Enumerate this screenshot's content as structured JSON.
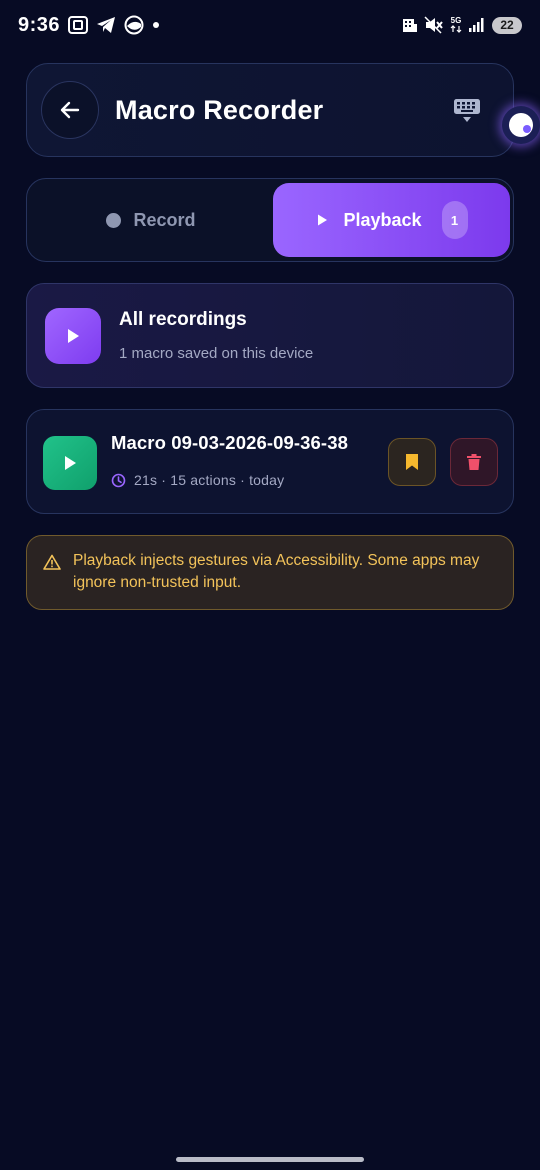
{
  "status_bar": {
    "time": "9:36",
    "battery": "22",
    "network": "5G"
  },
  "header": {
    "title": "Macro Recorder"
  },
  "mode_toggle": {
    "record_label": "Record",
    "playback_label": "Playback",
    "playback_count": "1",
    "active": "playback"
  },
  "all_recordings": {
    "title": "All recordings",
    "subtitle": "1 macro saved on this device"
  },
  "macros": [
    {
      "name": "Macro 09-03-2026-09-36-38",
      "meta": "21s · 15 actions · today"
    }
  ],
  "warning": {
    "text": "Playback injects gestures via Accessibility. Some apps may ignore non-trusted input."
  },
  "colors": {
    "background": "#070b24",
    "accent_purple": "#8b52f8",
    "play_green": "#18b07a",
    "warning_yellow": "#f3c35a",
    "bookmark_yellow": "#f5b82e",
    "delete_red": "#f0506a"
  },
  "icons": {
    "back": "arrow-left-icon",
    "keyboard": "keyboard-icon",
    "play": "play-icon",
    "clock": "clock-icon",
    "bookmark": "bookmark-icon",
    "delete": "trash-icon",
    "warning": "warning-triangle-icon"
  }
}
